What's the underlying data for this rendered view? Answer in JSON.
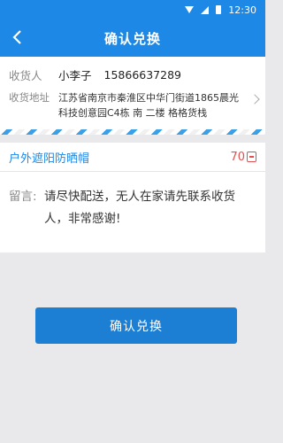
{
  "status_bar": {
    "time": "12:30"
  },
  "header": {
    "title": "确认兑换",
    "back_icon": "chevron-left-icon"
  },
  "address": {
    "recipient_label": "收货人",
    "recipient_name": "小李子",
    "recipient_phone": "15866637289",
    "address_label": "收货地址",
    "address_text": "江苏省南京市秦淮区中华门街道1865晨光科技创意园C4栋 南 二楼 格格货栈"
  },
  "product": {
    "name": "户外遮阳防晒帽",
    "points": "70"
  },
  "message": {
    "label": "留言:",
    "text": "请尽快配送，无人在家请先联系收货人，非常感谢!"
  },
  "submit": {
    "label": "确认兑换"
  },
  "colors": {
    "primary": "#1d88e5",
    "price": "#e05050"
  }
}
